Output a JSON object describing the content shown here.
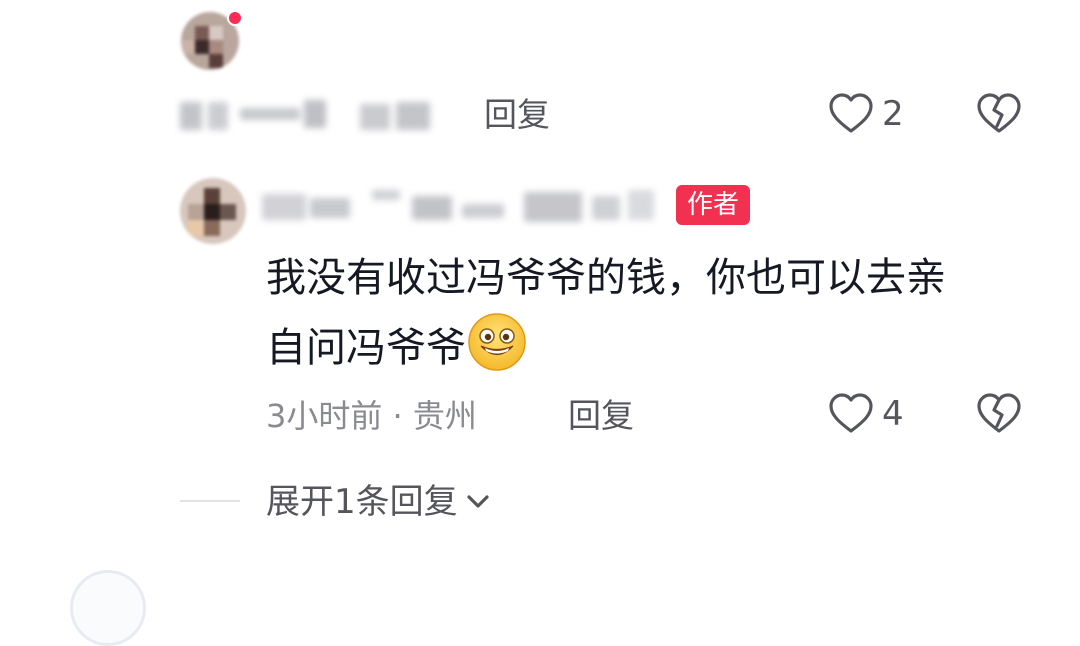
{
  "comments": [
    {
      "time_location": "3小时前 · 贵州",
      "reply_label": "回复",
      "like_count": "2",
      "icons": [
        "heart-icon",
        "broken-heart-icon"
      ],
      "text_obscured": true
    },
    {
      "author_tag": "作者",
      "text_line1": "我没有收过冯爷爷的钱，你也可以去亲",
      "text_line2": "自问冯爷爷",
      "emoji": "grinning-face-emoji",
      "time_location": "3小时前 · 贵州",
      "reply_label": "回复",
      "like_count": "4",
      "icons": [
        "heart-icon",
        "broken-heart-icon"
      ]
    }
  ],
  "expand_replies": {
    "label": "展开1条回复",
    "icon": "chevron-down-icon"
  },
  "colors": {
    "author_tag_bg": "#f2304f",
    "text": "#161823",
    "meta": "#8a8b91",
    "action": "#55565c"
  }
}
